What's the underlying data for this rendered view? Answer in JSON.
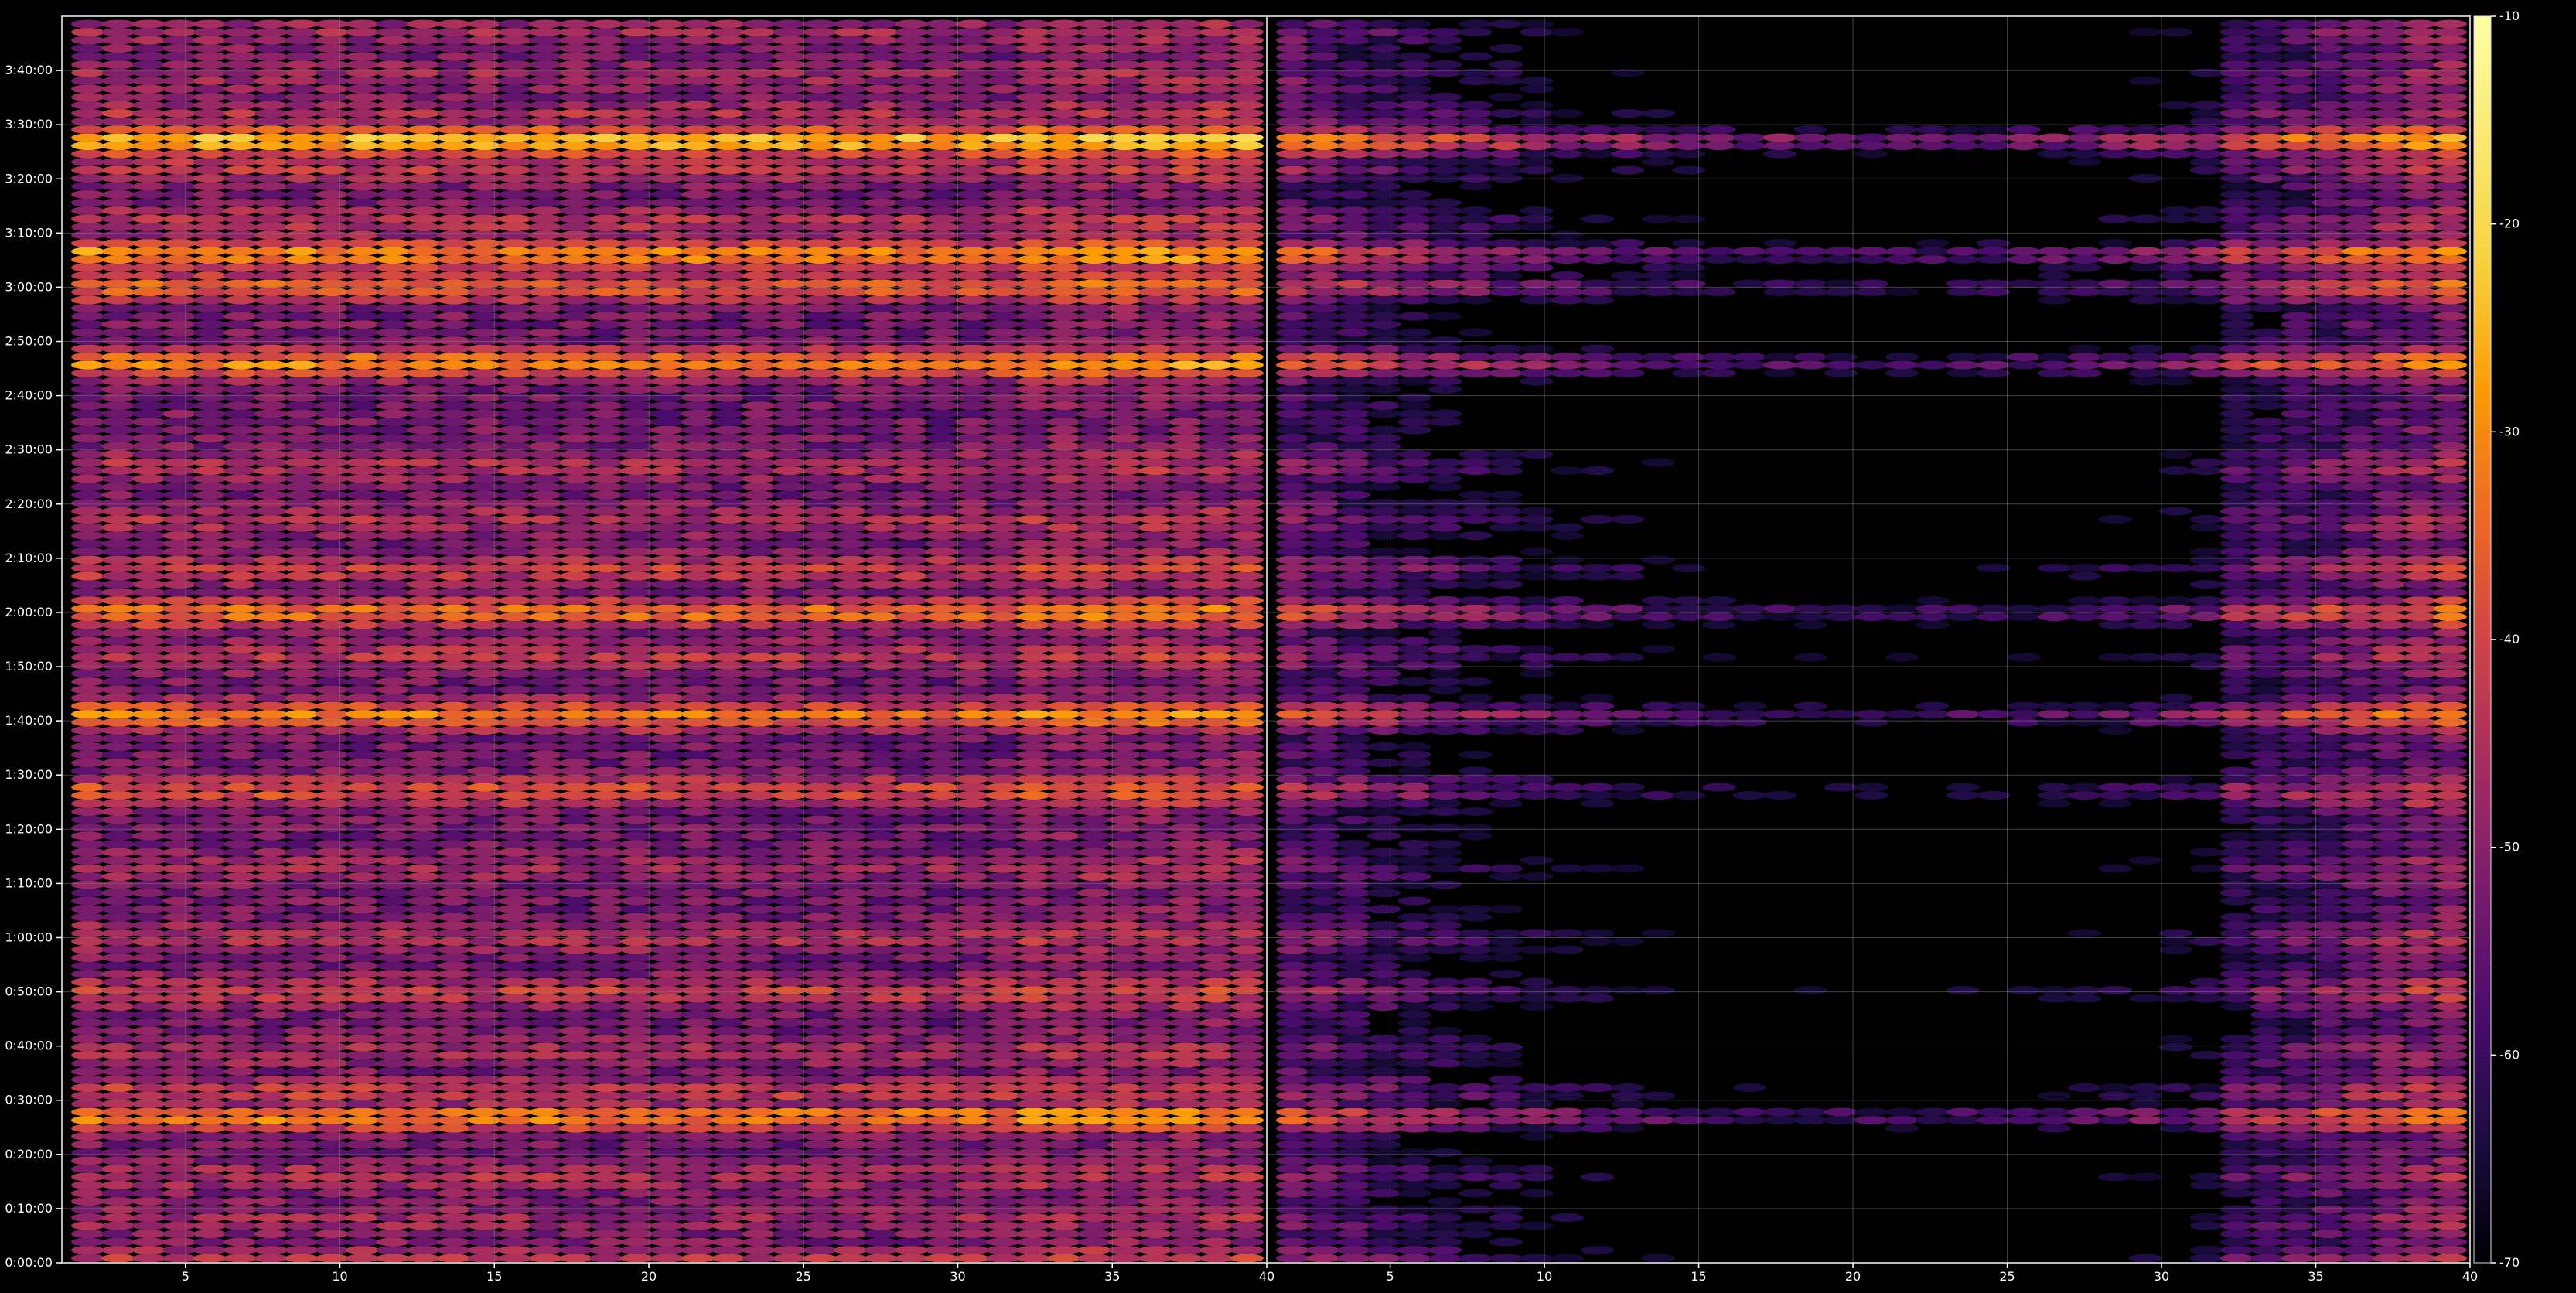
{
  "chart_data": {
    "type": "heatmap",
    "title": "",
    "xlabel": "",
    "ylabel": "",
    "grid": true,
    "colormap": "inferno",
    "panels": [
      {
        "name": "",
        "xlim": [
          1,
          40
        ],
        "xticks": [
          "5",
          "10",
          "15",
          "20",
          "25",
          "30",
          "35",
          "40"
        ]
      },
      {
        "name": "",
        "xlim": [
          1,
          40
        ],
        "xticks": [
          "5",
          "10",
          "15",
          "20",
          "25",
          "30",
          "35",
          "40"
        ]
      }
    ],
    "ylim_minutes": [
      0,
      230
    ],
    "yticks": [
      "0:00:00",
      "0:10:00",
      "0:20:00",
      "0:30:00",
      "0:40:00",
      "0:50:00",
      "1:00:00",
      "1:10:00",
      "1:20:00",
      "1:30:00",
      "1:40:00",
      "1:50:00",
      "2:00:00",
      "2:10:00",
      "2:20:00",
      "2:30:00",
      "2:40:00",
      "2:50:00",
      "3:00:00",
      "3:10:00",
      "3:20:00",
      "3:30:00",
      "3:40:00"
    ],
    "colorbar": {
      "range": [
        -70,
        -10
      ],
      "ticks": [
        "-10",
        "-20",
        "-30",
        "-40",
        "-50",
        "-60",
        "-70"
      ]
    },
    "band_rows_minutes": [
      {
        "t": 0.5,
        "a": -42,
        "b": -50
      },
      {
        "t": 8,
        "a": -46,
        "b": -60
      },
      {
        "t": 16,
        "a": -44,
        "b": -52
      },
      {
        "t": 27,
        "a": -28,
        "b": -48
      },
      {
        "t": 31.5,
        "a": -40,
        "b": -55
      },
      {
        "t": 39,
        "a": -45,
        "b": -62
      },
      {
        "t": 50,
        "a": -40,
        "b": -52
      },
      {
        "t": 60,
        "a": -44,
        "b": -55
      },
      {
        "t": 73,
        "a": -46,
        "b": -60
      },
      {
        "t": 87,
        "a": -36,
        "b": -52
      },
      {
        "t": 101,
        "a": -30,
        "b": -48
      },
      {
        "t": 112,
        "a": -42,
        "b": -56
      },
      {
        "t": 120,
        "a": -30,
        "b": -47
      },
      {
        "t": 128,
        "a": -40,
        "b": -55
      },
      {
        "t": 137,
        "a": -44,
        "b": -57
      },
      {
        "t": 147,
        "a": -44,
        "b": -60
      },
      {
        "t": 166,
        "a": -28,
        "b": -45
      },
      {
        "t": 180,
        "a": -33,
        "b": -52
      },
      {
        "t": 186,
        "a": -26,
        "b": -44
      },
      {
        "t": 192,
        "a": -42,
        "b": -54
      },
      {
        "t": 202,
        "a": -42,
        "b": -55
      },
      {
        "t": 207,
        "a": -20,
        "b": -36
      },
      {
        "t": 212,
        "a": -44,
        "b": -54
      },
      {
        "t": 219,
        "a": -46,
        "b": -58
      },
      {
        "t": 227,
        "a": -46,
        "b": -60
      }
    ]
  }
}
